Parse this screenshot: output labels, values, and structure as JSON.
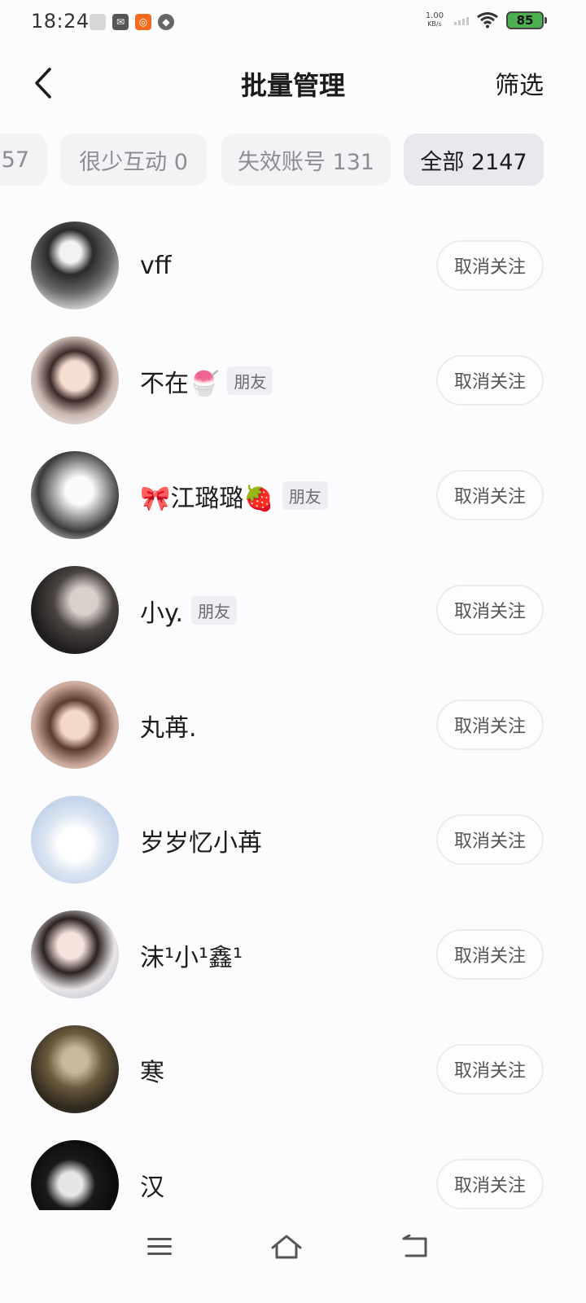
{
  "status_bar": {
    "time": "18:24",
    "net_speed_value": "1.00",
    "net_speed_unit": "KB/s",
    "battery": "85"
  },
  "header": {
    "title": "批量管理",
    "filter_label": "筛选"
  },
  "tabs": [
    {
      "label": "57"
    },
    {
      "label": "很少互动 0"
    },
    {
      "label": "失效账号 131"
    },
    {
      "label": "全部 2147",
      "active": true
    }
  ],
  "users": [
    {
      "name": "vff",
      "friend_tag": "",
      "button": "取消关注"
    },
    {
      "name": "不在🍧",
      "friend_tag": "朋友",
      "button": "取消关注"
    },
    {
      "name": "🎀江璐璐🍓",
      "friend_tag": "朋友",
      "button": "取消关注"
    },
    {
      "name": "小y.",
      "friend_tag": "朋友",
      "button": "取消关注"
    },
    {
      "name": "丸苒.",
      "friend_tag": "",
      "button": "取消关注"
    },
    {
      "name": "岁岁忆小苒",
      "friend_tag": "",
      "button": "取消关注"
    },
    {
      "name": "沫¹小¹鑫¹",
      "friend_tag": "",
      "button": "取消关注"
    },
    {
      "name": "寒",
      "friend_tag": "",
      "button": "取消关注"
    },
    {
      "name": "汉",
      "friend_tag": "",
      "button": "取消关注"
    }
  ],
  "nav": {
    "icons": [
      "menu-icon",
      "home-icon",
      "back-icon"
    ]
  },
  "colors": {
    "background": "#fcfbfd",
    "battery_fill": "#4caf50",
    "tab_bg": "#f3f2f5",
    "tab_active_bg": "#e9e8ec"
  }
}
